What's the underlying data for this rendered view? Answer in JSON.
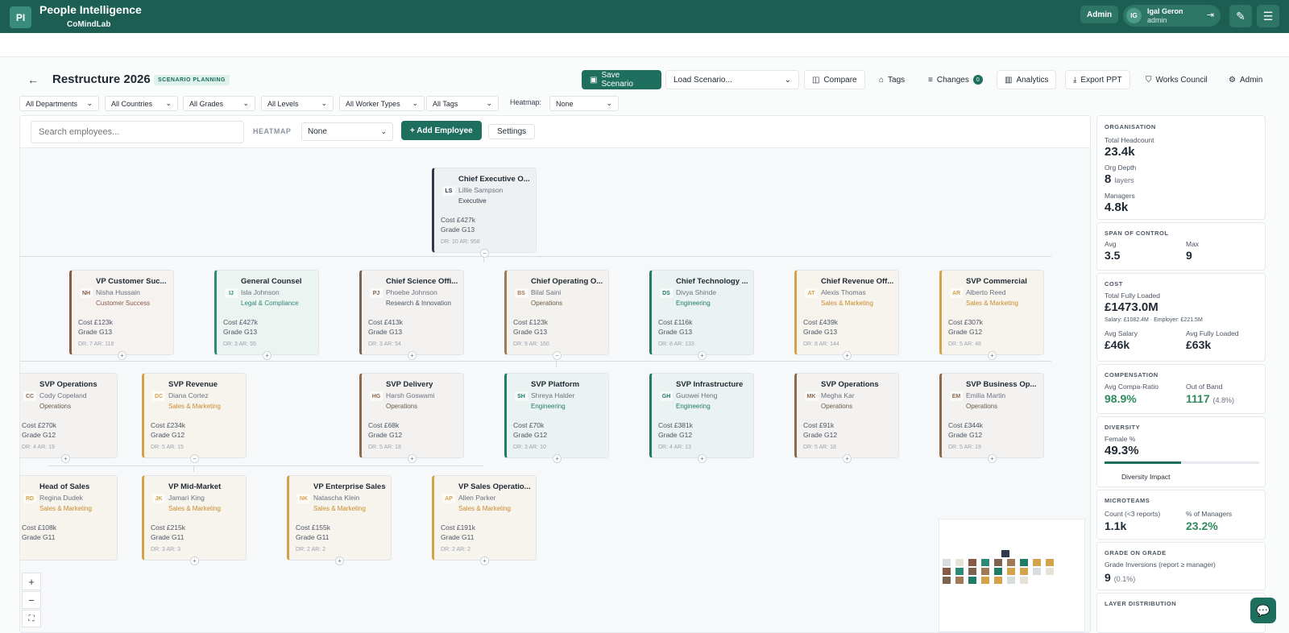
{
  "app": {
    "logo": "PI",
    "title": "People Intelligence",
    "org": "CoMindLab"
  },
  "topbar": {
    "admin_label": "Admin",
    "user_initials": "IG",
    "user_name": "Igal Geron",
    "user_role": "admin"
  },
  "scenario": {
    "title": "Restructure 2026",
    "badge": "SCENARIO PLANNING"
  },
  "toolbar": {
    "save": "Save Scenario",
    "load_placeholder": "Load Scenario...",
    "compare": "Compare",
    "tags": "Tags",
    "changes": "Changes",
    "changes_count": "0",
    "analytics": "Analytics",
    "export": "Export PPT",
    "works_council": "Works Council",
    "admin": "Admin"
  },
  "filters": {
    "departments": "All Departments",
    "countries": "All Countries",
    "grades": "All Grades",
    "levels": "All Levels",
    "worker_types": "All Worker Types",
    "tags": "All Tags",
    "heatmap_label": "Heatmap:",
    "heatmap_value": "None"
  },
  "canvas": {
    "search_placeholder": "Search employees...",
    "heatmap_label": "HEATMAP",
    "heatmap_value": "None",
    "add_employee": "+ Add Employee",
    "settings": "Settings"
  },
  "nodes": [
    {
      "title": "Chief Executive O...",
      "initials": "LS",
      "name": "Lillie Sampson",
      "dept": "Executive",
      "cost": "Cost £427k",
      "grade": "Grade G13",
      "drar": "DR: 10  AR: 958",
      "color": "#2f3a4c",
      "deptcolor": "#374151",
      "bg": "#eef0f2",
      "exp": "−"
    },
    {
      "title": "VP Customer Suc...",
      "initials": "NH",
      "name": "Nisha Hussain",
      "dept": "Customer Success",
      "cost": "Cost £123k",
      "grade": "Grade G13",
      "drar": "DR: 7  AR: 118",
      "color": "#8a5a48",
      "deptcolor": "#8a5a48",
      "bg": "#f5f2f0",
      "exp": "+"
    },
    {
      "title": "General Counsel",
      "initials": "IJ",
      "name": "Isla Johnson",
      "dept": "Legal & Compliance",
      "cost": "Cost £427k",
      "grade": "Grade G13",
      "drar": "DR: 3  AR: 55",
      "color": "#2b8a78",
      "deptcolor": "#2b8a78",
      "bg": "#ecf4f2",
      "exp": "+"
    },
    {
      "title": "Chief Science Offi...",
      "initials": "PJ",
      "name": "Phoebe Johnson",
      "dept": "Research & Innovation",
      "cost": "Cost £413k",
      "grade": "Grade G13",
      "drar": "DR: 3  AR: 54",
      "color": "#7b6450",
      "deptcolor": "#4b5563",
      "bg": "#f3f2f0",
      "exp": "+"
    },
    {
      "title": "Chief Operating O...",
      "initials": "BS",
      "name": "Bilal Saini",
      "dept": "Operations",
      "cost": "Cost £123k",
      "grade": "Grade G13",
      "drar": "DR: 9  AR: 160",
      "color": "#a07a55",
      "deptcolor": "#6b5a45",
      "bg": "#f4f2ef",
      "exp": "−"
    },
    {
      "title": "Chief Technology ...",
      "initials": "DS",
      "name": "Divya Shinde",
      "dept": "Engineering",
      "cost": "Cost £116k",
      "grade": "Grade G13",
      "drar": "DR: 8  AR: 133",
      "color": "#1f7a66",
      "deptcolor": "#1f7a66",
      "bg": "#eaf3f1",
      "exp": "+"
    },
    {
      "title": "Chief Revenue Off...",
      "initials": "AT",
      "name": "Alexis Thomas",
      "dept": "Sales & Marketing",
      "cost": "Cost £439k",
      "grade": "Grade G13",
      "drar": "DR: 8  AR: 144",
      "color": "#d4a24a",
      "deptcolor": "#c98b2b",
      "bg": "#f7f4ee",
      "exp": "+"
    },
    {
      "title": "SVP Commercial",
      "initials": "AR",
      "name": "Alberto Reed",
      "dept": "Sales & Marketing",
      "cost": "Cost £307k",
      "grade": "Grade G12",
      "drar": "DR: 5  AR: 48",
      "color": "#d4a24a",
      "deptcolor": "#c98b2b",
      "bg": "#f7f4ee",
      "exp": "+"
    },
    {
      "title": "SVP Operations",
      "initials": "CC",
      "name": "Cody Copeland",
      "dept": "Operations",
      "cost": "Cost £270k",
      "grade": "Grade G12",
      "drar": "DR: 4  AR: 19",
      "color": "#8a6a50",
      "deptcolor": "#6b5a45",
      "bg": "#f3f2f0",
      "exp": "+"
    },
    {
      "title": "SVP Revenue",
      "initials": "DC",
      "name": "Diana Cortez",
      "dept": "Sales & Marketing",
      "cost": "Cost £234k",
      "grade": "Grade G12",
      "drar": "DR: 5  AR: 15",
      "color": "#d4a24a",
      "deptcolor": "#c98b2b",
      "bg": "#f7f4ee",
      "exp": "−"
    },
    {
      "title": "SVP Delivery",
      "initials": "HG",
      "name": "Harsh Goswami",
      "dept": "Operations",
      "cost": "Cost £68k",
      "grade": "Grade G12",
      "drar": "DR: 5  AR: 18",
      "color": "#8a6a50",
      "deptcolor": "#6b5a45",
      "bg": "#f3f2f0",
      "exp": "+"
    },
    {
      "title": "SVP Platform",
      "initials": "SH",
      "name": "Shreya Halder",
      "dept": "Engineering",
      "cost": "Cost £70k",
      "grade": "Grade G12",
      "drar": "DR: 3  AR: 10",
      "color": "#1f7a66",
      "deptcolor": "#1f7a66",
      "bg": "#eaf3f1",
      "exp": "+"
    },
    {
      "title": "SVP Infrastructure",
      "initials": "GH",
      "name": "Guowei Heng",
      "dept": "Engineering",
      "cost": "Cost £381k",
      "grade": "Grade G12",
      "drar": "DR: 4  AR: 13",
      "color": "#1f7a66",
      "deptcolor": "#1f7a66",
      "bg": "#eaf3f1",
      "exp": "+"
    },
    {
      "title": "SVP Operations",
      "initials": "MK",
      "name": "Megha Kar",
      "dept": "Operations",
      "cost": "Cost £91k",
      "grade": "Grade G12",
      "drar": "DR: 5  AR: 18",
      "color": "#8a6a50",
      "deptcolor": "#6b5a45",
      "bg": "#f3f2f0",
      "exp": "+"
    },
    {
      "title": "SVP Business Op...",
      "initials": "EM",
      "name": "Emilia Martin",
      "dept": "Operations",
      "cost": "Cost £344k",
      "grade": "Grade G12",
      "drar": "DR: 5  AR: 19",
      "color": "#8a6a50",
      "deptcolor": "#6b5a45",
      "bg": "#f3f2f0",
      "exp": "+"
    },
    {
      "title": "Head of Sales",
      "initials": "RD",
      "name": "Regina Dudek",
      "dept": "Sales & Marketing",
      "cost": "Cost £108k",
      "grade": "Grade G11",
      "drar": "",
      "color": "#d4a24a",
      "deptcolor": "#c98b2b",
      "bg": "#f7f4ee",
      "exp": ""
    },
    {
      "title": "VP Mid-Market",
      "initials": "JK",
      "name": "Jamari King",
      "dept": "Sales & Marketing",
      "cost": "Cost £215k",
      "grade": "Grade G11",
      "drar": "DR: 3  AR: 3",
      "color": "#d4a24a",
      "deptcolor": "#c98b2b",
      "bg": "#f7f4ee",
      "exp": "+"
    },
    {
      "title": "VP Enterprise Sales",
      "initials": "NK",
      "name": "Natascha Klein",
      "dept": "Sales & Marketing",
      "cost": "Cost £155k",
      "grade": "Grade G11",
      "drar": "DR: 2  AR: 2",
      "color": "#d4a24a",
      "deptcolor": "#c98b2b",
      "bg": "#f7f4ee",
      "exp": "+"
    },
    {
      "title": "VP Sales Operatio...",
      "initials": "AP",
      "name": "Allen Parker",
      "dept": "Sales & Marketing",
      "cost": "Cost £191k",
      "grade": "Grade G11",
      "drar": "DR: 2  AR: 2",
      "color": "#d4a24a",
      "deptcolor": "#c98b2b",
      "bg": "#f7f4ee",
      "exp": "+"
    }
  ],
  "zoom": {
    "in": "+",
    "out": "−",
    "fit": "⛶"
  },
  "metrics": {
    "org": {
      "header": "ORGANISATION",
      "hc_label": "Total Headcount",
      "hc": "23.4k",
      "depth_label": "Org Depth",
      "depth": "8",
      "depth_unit": "layers",
      "mgr_label": "Managers",
      "mgr": "4.8k"
    },
    "span": {
      "header": "SPAN OF CONTROL",
      "avg_label": "Avg",
      "avg": "3.5",
      "max_label": "Max",
      "max": "9"
    },
    "cost": {
      "header": "COST",
      "total_label": "Total Fully Loaded",
      "total": "£1473.0M",
      "breakdown": "Salary: £1082.4M · Employer: £221.5M",
      "avg_sal_label": "Avg Salary",
      "avg_sal": "£46k",
      "avg_fl_label": "Avg Fully Loaded",
      "avg_fl": "£63k"
    },
    "comp": {
      "header": "COMPENSATION",
      "cr_label": "Avg Compa-Ratio",
      "cr": "98.9%",
      "oob_label": "Out of Band",
      "oob": "1117",
      "oob_pct": "(4.8%)"
    },
    "diversity": {
      "header": "DIVERSITY",
      "female_label": "Female %",
      "female": "49.3%",
      "female_fraction": 0.493,
      "impact": "Diversity Impact"
    },
    "micro": {
      "header": "MICROTEAMS",
      "count_label": "Count (<3 reports)",
      "count": "1.1k",
      "pct_label": "% of Managers",
      "pct": "23.2%"
    },
    "gog": {
      "header": "GRADE ON GRADE",
      "inv_label": "Grade Inversions (report ≥ manager)",
      "inv": "9",
      "inv_pct": "(0.1%)"
    },
    "layer": {
      "header": "LAYER DISTRIBUTION"
    }
  }
}
